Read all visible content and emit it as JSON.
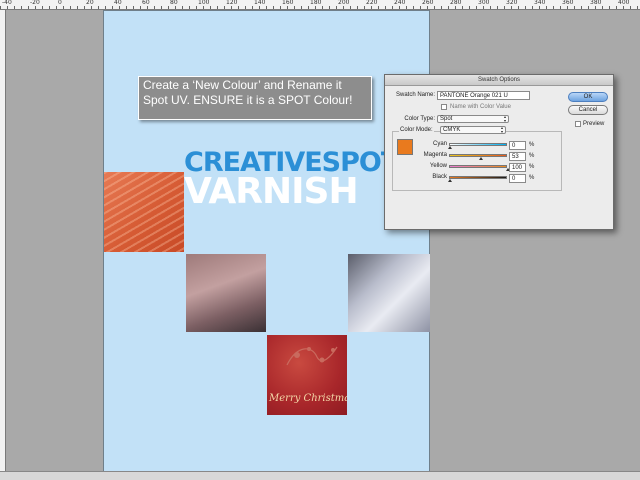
{
  "rulers": {
    "top_ticks": [
      "-40",
      "-20",
      "0",
      "20",
      "40",
      "60",
      "80",
      "100",
      "120",
      "140",
      "160",
      "180",
      "200",
      "220",
      "240",
      "260",
      "280",
      "300",
      "320",
      "340",
      "360",
      "380",
      "400"
    ]
  },
  "document": {
    "title_line1": "CREATIVESPOT",
    "title_line2": "VARNISH",
    "photo_caption": "Merry Christmas",
    "colors": {
      "page": "#c2e1f7",
      "title_blue": "#2b8fd6",
      "pasteboard": "#a9a9a9"
    }
  },
  "callout": {
    "line1": "Create a ‘New Colour’ and Rename it",
    "line2": "Spot UV. ENSURE it is a SPOT Colour!"
  },
  "swatch_dialog": {
    "title": "Swatch Options",
    "swatch_name_label": "Swatch Name:",
    "swatch_name_value": "PANTONE Orange 021 U",
    "name_with_color_value_label": "Name with Color Value",
    "color_type_label": "Color Type:",
    "color_type_value": "Spot",
    "color_mode_label": "Color Mode:",
    "color_mode_value": "CMYK",
    "swatch_color": "#e97a1e",
    "channels": [
      {
        "label": "Cyan",
        "value": "0",
        "fraction": 0.0,
        "unit": "%"
      },
      {
        "label": "Magenta",
        "value": "53",
        "fraction": 0.53,
        "unit": "%"
      },
      {
        "label": "Yellow",
        "value": "100",
        "fraction": 1.0,
        "unit": "%"
      },
      {
        "label": "Black",
        "value": "0",
        "fraction": 0.0,
        "unit": "%"
      }
    ],
    "ok_label": "OK",
    "cancel_label": "Cancel",
    "preview_label": "Preview"
  }
}
